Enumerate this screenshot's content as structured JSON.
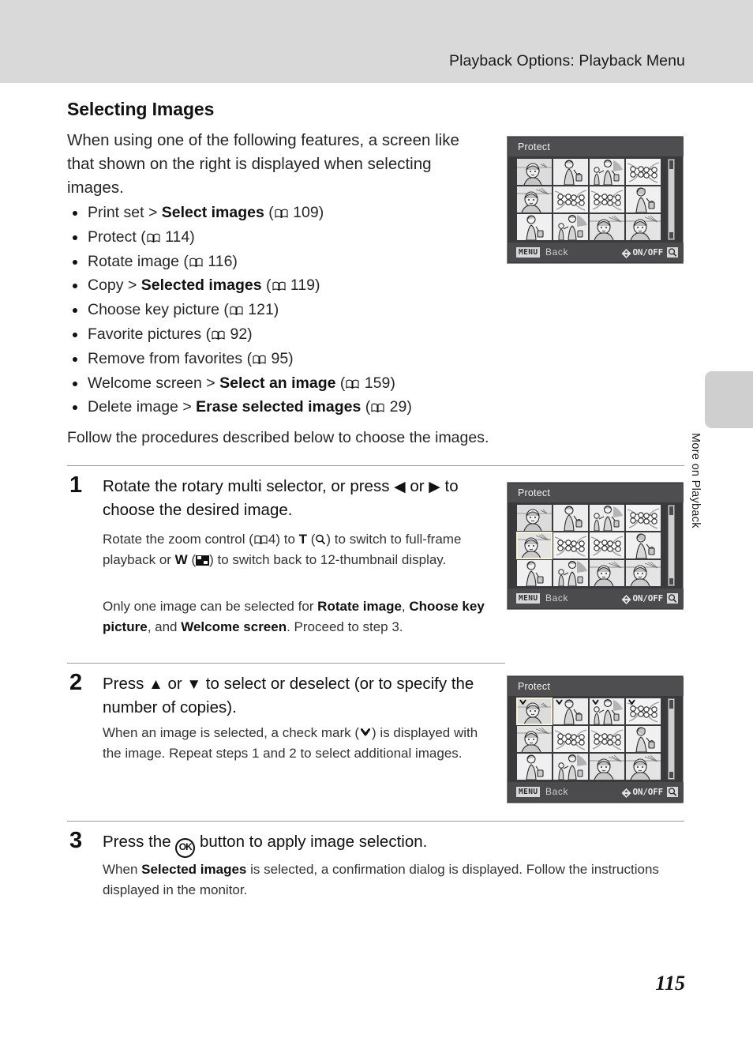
{
  "header": {
    "title": "Playback Options: Playback Menu"
  },
  "side_tab": {
    "label": "More on Playback"
  },
  "page": {
    "number": "115"
  },
  "section": {
    "title": "Selecting Images",
    "intro": "When using one of the following features, a screen like that shown on the right is displayed when selecting images.",
    "follow_text": "Follow the procedures described below to choose the images."
  },
  "feature_list": [
    {
      "pre": "Print set > ",
      "bold": "Select images",
      "ref": "109"
    },
    {
      "pre": "Protect ",
      "bold": "",
      "ref": "114"
    },
    {
      "pre": "Rotate image ",
      "bold": "",
      "ref": "116"
    },
    {
      "pre": "Copy > ",
      "bold": "Selected images",
      "ref": "119"
    },
    {
      "pre": "Choose key picture ",
      "bold": "",
      "ref": "121"
    },
    {
      "pre": "Favorite pictures ",
      "bold": "",
      "ref": "92"
    },
    {
      "pre": "Remove from favorites ",
      "bold": "",
      "ref": "95"
    },
    {
      "pre": "Welcome screen > ",
      "bold": "Select an image",
      "ref": "159"
    },
    {
      "pre": "Delete image > ",
      "bold": "Erase selected images",
      "ref": "29"
    }
  ],
  "steps": [
    {
      "number": "1",
      "heading_a": "Rotate the rotary multi selector, or press ",
      "heading_b": " or ",
      "heading_c": " to choose the desired image.",
      "body1_a": "Rotate the zoom control (",
      "body1_ref": "4",
      "body1_b": ") to ",
      "body1_T": "T",
      "body1_c": " (",
      "body1_d": ") to switch to full-frame playback or ",
      "body1_W": "W",
      "body1_e": " (",
      "body1_f": ") to switch back to 12-thumbnail display.",
      "body2_a": "Only one image can be selected for ",
      "body2_b1": "Rotate image",
      "body2_c": ", ",
      "body2_b2": "Choose key picture",
      "body2_d": ", and ",
      "body2_b3": "Welcome screen",
      "body2_e": ". Proceed to step 3."
    },
    {
      "number": "2",
      "heading_a": "Press ",
      "heading_b": " or ",
      "heading_c": " to select or deselect (or to specify the number of copies).",
      "body_a": "When an image is selected, a check mark (",
      "body_b": ") is displayed with the image. Repeat steps 1 and 2 to select additional images."
    },
    {
      "number": "3",
      "heading_a": "Press the ",
      "heading_b": " button to apply image selection.",
      "body_a": "When ",
      "body_bold": "Selected images",
      "body_b": " is selected, a confirmation dialog is displayed. Follow the instructions displayed in the monitor."
    }
  ],
  "lcd_screens": [
    {
      "title": "Protect",
      "back_label": "Back",
      "menu_label": "MENU",
      "onoff_label": "ON/OFF",
      "selected_index": -1,
      "checked": []
    },
    {
      "title": "Protect",
      "back_label": "Back",
      "menu_label": "MENU",
      "onoff_label": "ON/OFF",
      "selected_index": 4,
      "checked": []
    },
    {
      "title": "Protect",
      "back_label": "Back",
      "menu_label": "MENU",
      "onoff_label": "ON/OFF",
      "selected_index": 0,
      "checked": [
        0,
        1,
        2,
        3
      ]
    }
  ],
  "colors": {
    "header_band": "#d9d9d9",
    "side_tab": "#cfcfcf",
    "lcd_body": "#3a3a3c",
    "lcd_title_bar": "#4e4e50",
    "lcd_bottom_bar": "#4b4b4d",
    "selection_highlight": "#f5f3d8",
    "thumb_bg": "#d7d7d7"
  }
}
